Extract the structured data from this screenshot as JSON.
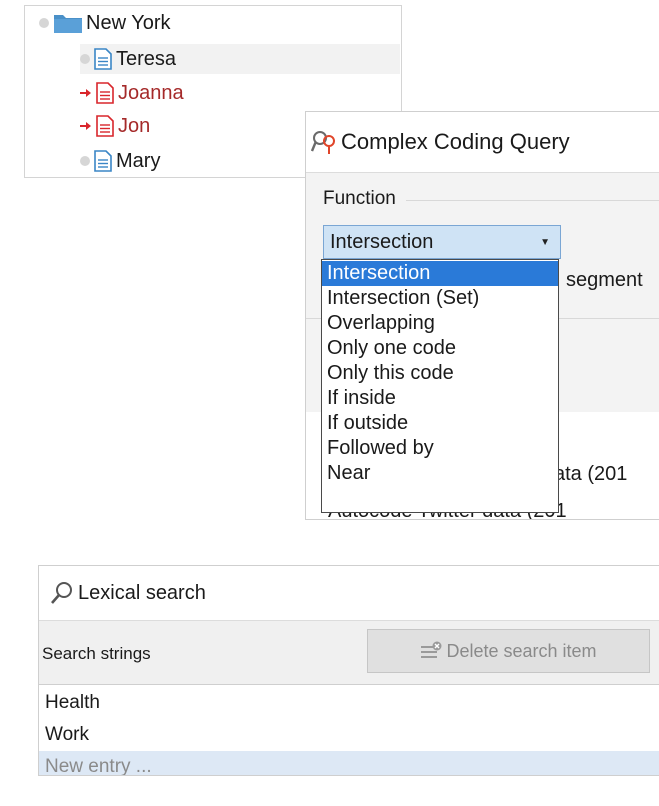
{
  "tree": {
    "root": {
      "label": "New York",
      "icon": "folder-icon"
    },
    "items": [
      {
        "label": "Teresa",
        "coded": false
      },
      {
        "label": "Joanna",
        "coded": true
      },
      {
        "label": "Jon",
        "coded": true
      },
      {
        "label": "Mary",
        "coded": false
      }
    ]
  },
  "ccq": {
    "title": "Complex Coding Query",
    "function_label": "Function",
    "selected": "Intersection",
    "options": [
      "Intersection",
      "Intersection (Set)",
      "Overlapping",
      "Only one code",
      "Only this code",
      "If inside",
      "If outside",
      "Followed by",
      "Near"
    ],
    "peek_segment": "segment",
    "peek_data_1": "ata (201",
    "peek_data_2": "Autocode Twitter data (201"
  },
  "lexical": {
    "title": "Lexical search",
    "search_strings_label": "Search strings",
    "delete_button": "Delete search item",
    "entries": [
      "Health",
      "Work"
    ],
    "new_entry": "New entry ..."
  },
  "colors": {
    "coded_text": "#a52a2a",
    "coded_icon": "#d9262c",
    "folder": "#4a90c8",
    "dropdown_selected": "#2a7ad8",
    "select_bg": "#cfe3f5"
  }
}
